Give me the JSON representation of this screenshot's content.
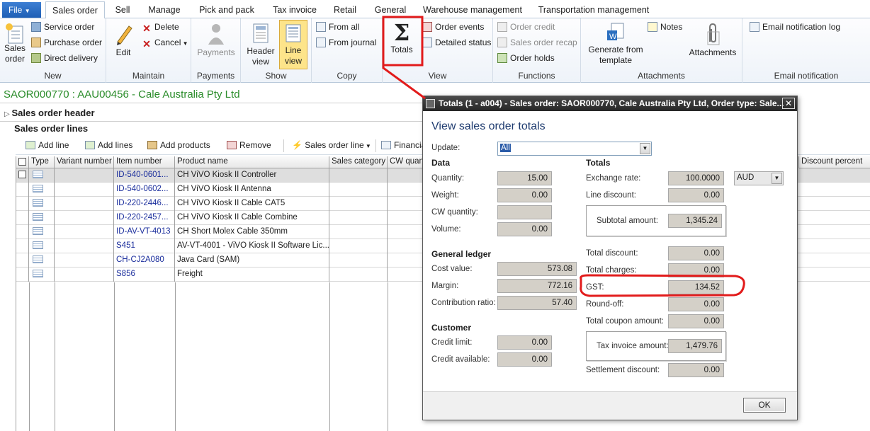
{
  "tabs": {
    "file": "File",
    "items": [
      "Sales order",
      "Sell",
      "Manage",
      "Pick and pack",
      "Tax invoice",
      "Retail",
      "General",
      "Warehouse management",
      "Transportation management"
    ]
  },
  "ribbon": {
    "new": {
      "sales_order": "Sales order",
      "service_order": "Service order",
      "purchase_order": "Purchase order",
      "direct_delivery": "Direct delivery",
      "label": "New"
    },
    "maintain": {
      "edit": "Edit",
      "delete": "Delete",
      "cancel": "Cancel",
      "label": "Maintain"
    },
    "payments": {
      "payments": "Payments",
      "label": "Payments"
    },
    "show": {
      "header_view": "Header view",
      "line_view": "Line view",
      "label": "Show"
    },
    "copy": {
      "from_all": "From all",
      "from_journal": "From journal",
      "label": "Copy"
    },
    "view": {
      "totals": "Totals",
      "order_events": "Order events",
      "detailed_status": "Detailed status",
      "label": "View"
    },
    "functions": {
      "order_credit": "Order credit",
      "sales_order_recap": "Sales order recap",
      "order_holds": "Order holds",
      "label": "Functions"
    },
    "attachments": {
      "generate_from_template": "Generate from template",
      "notes": "Notes",
      "attachments": "Attachments",
      "label": "Attachments"
    },
    "email": {
      "log": "Email notification log",
      "label": "Email notification"
    }
  },
  "page_title": "SAOR000770 : AAU00456 - Cale Australia Pty Ltd",
  "sections": {
    "header": "Sales order header",
    "lines": "Sales order lines"
  },
  "line_toolbar": {
    "add_line": "Add line",
    "add_lines": "Add lines",
    "add_products": "Add products",
    "remove": "Remove",
    "sales_order_line": "Sales order line",
    "financials": "Financials"
  },
  "grid": {
    "columns": [
      "Type",
      "Variant number",
      "Item number",
      "Product name",
      "Sales category",
      "CW quantity",
      "Discount percent"
    ],
    "rows": [
      {
        "item": "ID-540-0601...",
        "product": "CH ViVO Kiosk II Controller"
      },
      {
        "item": "ID-540-0602...",
        "product": "CH ViVO Kiosk II Antenna"
      },
      {
        "item": "ID-220-2446...",
        "product": "CH ViVO Kiosk II Cable CAT5"
      },
      {
        "item": "ID-220-2457...",
        "product": "CH ViVO Kiosk II Cable Combine"
      },
      {
        "item": "ID-AV-VT-4013",
        "product": "CH Short Molex Cable 350mm"
      },
      {
        "item": "S451",
        "product": "AV-VT-4001 - ViVO Kiosk II Software Lic..."
      },
      {
        "item": "CH-CJ2A080",
        "product": "Java Card (SAM)"
      },
      {
        "item": "S856",
        "product": "Freight"
      }
    ]
  },
  "dialog": {
    "title": "Totals (1 - a004) - Sales order: SAOR000770, Cale Australia Pty Ltd, Order type: Sale...",
    "close": "✕",
    "heading": "View sales order totals",
    "update_label": "Update:",
    "update_value": "All",
    "data": {
      "title": "Data",
      "quantity_label": "Quantity:",
      "quantity": "15.00",
      "weight_label": "Weight:",
      "weight": "0.00",
      "cw_label": "CW quantity:",
      "cw": "",
      "volume_label": "Volume:",
      "volume": "0.00"
    },
    "gl": {
      "title": "General ledger",
      "cost_label": "Cost value:",
      "cost": "573.08",
      "margin_label": "Margin:",
      "margin": "772.16",
      "ratio_label": "Contribution ratio:",
      "ratio": "57.40"
    },
    "customer": {
      "title": "Customer",
      "credit_limit_label": "Credit limit:",
      "credit_limit": "0.00",
      "credit_available_label": "Credit available:",
      "credit_available": "0.00"
    },
    "totals": {
      "title": "Totals",
      "exchange_label": "Exchange rate:",
      "exchange": "100.0000",
      "currency": "AUD",
      "line_discount_label": "Line discount:",
      "line_discount": "0.00",
      "subtotal_label": "Subtotal amount:",
      "subtotal": "1,345.24",
      "total_discount_label": "Total discount:",
      "total_discount": "0.00",
      "total_charges_label": "Total charges:",
      "total_charges": "0.00",
      "gst_label": "GST:",
      "gst": "134.52",
      "roundoff_label": "Round-off:",
      "roundoff": "0.00",
      "coupon_label": "Total coupon amount:",
      "coupon": "0.00",
      "invoice_label": "Tax invoice amount:",
      "invoice": "1,479.76",
      "settlement_label": "Settlement discount:",
      "settlement": "0.00"
    },
    "ok": "OK"
  },
  "colors": {
    "accent": "#1f5fb5",
    "highlight": "#e21b1b",
    "title_green": "#2a8c2a",
    "line_view_active": "#fde48a"
  }
}
